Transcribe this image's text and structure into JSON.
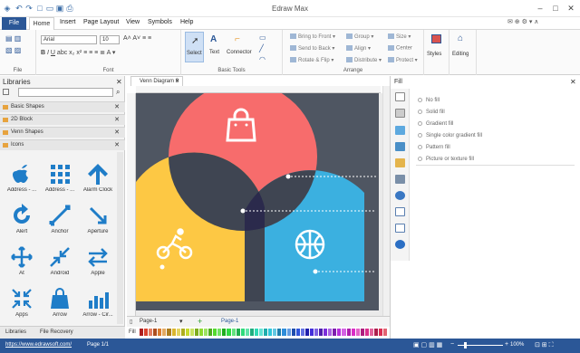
{
  "app": {
    "title": "Edraw Max"
  },
  "menu": {
    "file": "File",
    "items": [
      "Home",
      "Insert",
      "Page Layout",
      "View",
      "Symbols",
      "Help"
    ]
  },
  "ribbon": {
    "font_name": "Arial",
    "font_size": "10",
    "groups": [
      "File",
      "Font",
      "Basic Tools",
      "Arrange",
      "Styles",
      "Editing"
    ],
    "tools": {
      "select": "Select",
      "text": "Text",
      "connector": "Connector",
      "styles": "Styles",
      "editing": "Editing"
    },
    "arrange": [
      "Bring to Front",
      "Send to Back",
      "Rotate & Flip",
      "Group",
      "Align",
      "Distribute",
      "Size",
      "Center",
      "Protect"
    ]
  },
  "libraries": {
    "title": "Libraries",
    "search_placeholder": "",
    "sections": [
      "Basic Shapes",
      "2D Block",
      "Venn Shapes",
      "Icons"
    ],
    "shapes": [
      {
        "label": "Address - ...",
        "icon": "apple-icon"
      },
      {
        "label": "Address - ...",
        "icon": "grid-icon"
      },
      {
        "label": "Alarm Clock",
        "icon": "arrow-up-icon"
      },
      {
        "label": "Alert",
        "icon": "refresh-icon"
      },
      {
        "label": "Anchor",
        "icon": "diagonal-arrow-icon"
      },
      {
        "label": "Aperture",
        "icon": "diagonal-arrow-icon"
      },
      {
        "label": "At",
        "icon": "plus-icon"
      },
      {
        "label": "Android",
        "icon": "shrink-icon"
      },
      {
        "label": "Apple",
        "icon": "swap-arrows-icon"
      },
      {
        "label": "Apps",
        "icon": "collapse-icon"
      },
      {
        "label": "Arrow",
        "icon": "shopping-bag-icon"
      },
      {
        "label": "Arrow - Cir...",
        "icon": "bar-chart-icon"
      }
    ],
    "bottom_tabs": [
      "Libraries",
      "File Recovery"
    ]
  },
  "document": {
    "tab": "Venn Diagram 9",
    "page_label": "Page-1",
    "page_tab": "Page-1"
  },
  "venn": {
    "colors": {
      "red": "#F76C6C",
      "yellow": "#FDC844",
      "blue": "#3BB0E0",
      "bg": "#4F5662",
      "overlap": "#3F4552",
      "center": "#2B2A4C"
    }
  },
  "fill_panel": {
    "title": "Fill",
    "options": [
      "No fill",
      "Solid fill",
      "Gradient fill",
      "Single color gradient fill",
      "Pattern fill",
      "Picture or texture fill"
    ]
  },
  "statusbar": {
    "url": "https://www.edrawsoft.com/",
    "page": "Page 1/1",
    "zoom": "100%"
  },
  "palette_label": "Fill"
}
